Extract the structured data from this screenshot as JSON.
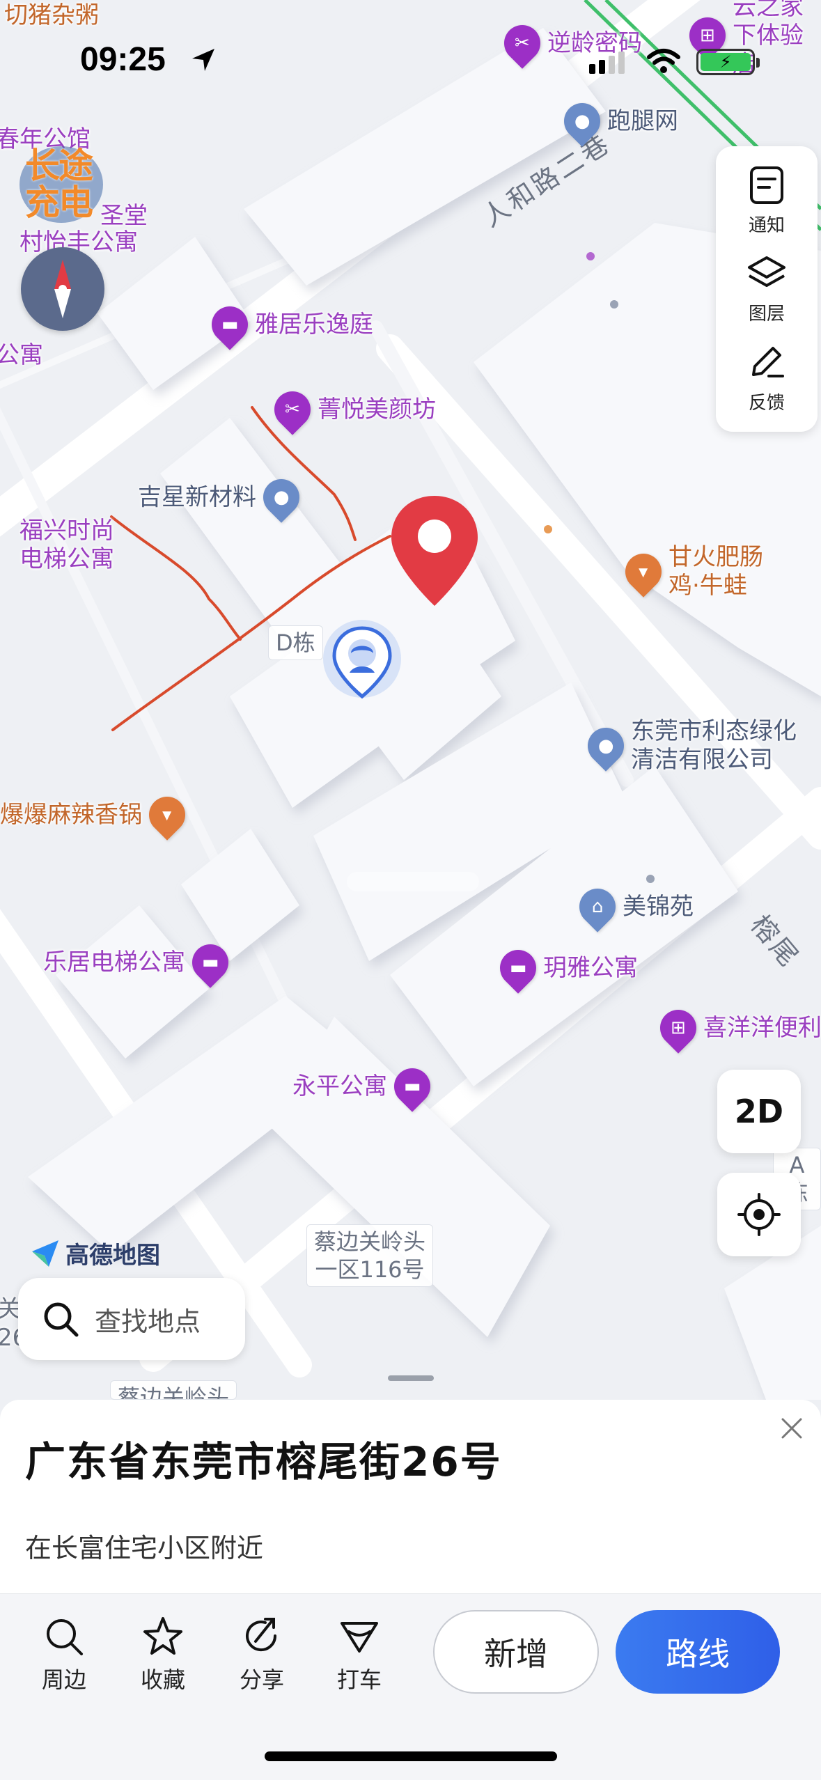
{
  "status_bar": {
    "time": "09:25"
  },
  "map": {
    "brand": "高德地图",
    "charge_badge": "长途\n充电",
    "road_labels": [
      "人和路二巷",
      "榕尾"
    ],
    "building_tags": [
      "D栋",
      "A栋",
      "蔡边关岭头\n一区116号",
      "蔡边关岭头"
    ],
    "partial_texts": [
      "春年公馆",
      "圣堂",
      "公寓",
      "关\n26"
    ],
    "pois": [
      {
        "name": "切猪杂粥",
        "color": "orange",
        "icon": "food-icon"
      },
      {
        "name": "逆龄密码",
        "color": "purple",
        "icon": "scissors-icon"
      },
      {
        "name": "云之家\n下体验店",
        "color": "purple",
        "icon": "cart-icon"
      },
      {
        "name": "跑腿网",
        "color": "blue",
        "icon": "place-icon"
      },
      {
        "name": "村怡丰公寓",
        "color": "purple",
        "icon": "hotel-icon"
      },
      {
        "name": "雅居乐逸庭",
        "color": "purple",
        "icon": "hotel-icon"
      },
      {
        "name": "菁悦美颜坊",
        "color": "purple",
        "icon": "scissors-icon"
      },
      {
        "name": "吉星新材料",
        "color": "blue",
        "icon": "place-icon"
      },
      {
        "name": "福兴时尚\n电梯公寓",
        "color": "purple",
        "icon": "hotel-icon"
      },
      {
        "name": "甘火肥肠\n鸡·牛蛙",
        "color": "orange",
        "icon": "food-icon"
      },
      {
        "name": "东莞市利态绿化\n清洁有限公司",
        "color": "blue",
        "icon": "place-icon"
      },
      {
        "name": "爆爆麻辣香锅",
        "color": "orange",
        "icon": "food-icon"
      },
      {
        "name": "美锦苑",
        "color": "blue",
        "icon": "home-icon"
      },
      {
        "name": "乐居电梯公寓",
        "color": "purple",
        "icon": "hotel-icon"
      },
      {
        "name": "玥雅公寓",
        "color": "purple",
        "icon": "hotel-icon"
      },
      {
        "name": "喜洋洋便利",
        "color": "purple",
        "icon": "cart-icon"
      },
      {
        "name": "永平公寓",
        "color": "purple",
        "icon": "hotel-icon"
      }
    ]
  },
  "tools": {
    "notify": "通知",
    "layers": "图层",
    "feedback": "反馈"
  },
  "view_toggle": "2D",
  "search": {
    "placeholder": "查找地点"
  },
  "sheet": {
    "address": "广东省东莞市榕尾街26号",
    "nearby": "在长富住宅小区附近"
  },
  "actions": {
    "nearby": "周边",
    "favorite": "收藏",
    "share": "分享",
    "taxi": "打车",
    "add": "新增",
    "route": "路线"
  },
  "colors": {
    "accent_blue": "#3b7bf0",
    "poi_purple": "#9c2fc6",
    "poi_blue": "#6a8cc8",
    "poi_orange": "#e07a3a",
    "destination_red": "#e23b44",
    "doodle_red": "#d84a2c"
  }
}
